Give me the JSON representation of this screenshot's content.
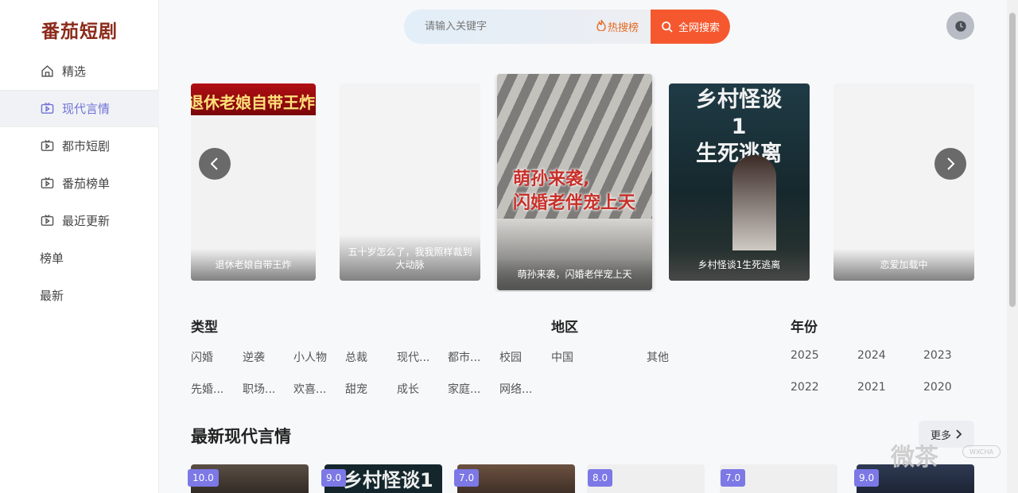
{
  "sidebar": {
    "logo": "番茄短剧",
    "items": [
      {
        "label": "精选",
        "icon": "home-icon"
      },
      {
        "label": "现代言情",
        "icon": "tv-play-icon",
        "active": true
      },
      {
        "label": "都市短剧",
        "icon": "tv-play-icon"
      },
      {
        "label": "番茄榜单",
        "icon": "tv-play-icon"
      },
      {
        "label": "最近更新",
        "icon": "tv-play-icon"
      },
      {
        "label": "榜单",
        "icon": ""
      },
      {
        "label": "最新",
        "icon": ""
      }
    ]
  },
  "header": {
    "search_placeholder": "请输入关键字",
    "hot_label": "热搜榜",
    "search_button": "全网搜索"
  },
  "carousel": {
    "items": [
      {
        "caption": "退休老娘自带王炸",
        "banner": "退休老娘自带王炸"
      },
      {
        "caption": "五十岁怎么了，我我照样裁到大动脉"
      },
      {
        "caption": "萌孙来袭，闪婚老伴宠上天",
        "poster_line1": "萌孙来袭,",
        "poster_line2": "闪婚老伴宠上天"
      },
      {
        "caption": "乡村怪谈1生死逃离",
        "poster_line1": "乡村怪谈1",
        "poster_line2": "生死逃离"
      },
      {
        "caption": "恋爱加载中"
      }
    ]
  },
  "filters": {
    "type_title": "类型",
    "type_tags": [
      "闪婚",
      "逆袭",
      "小人物",
      "总裁",
      "现代...",
      "都市...",
      "校园",
      "先婚...",
      "职场...",
      "欢喜...",
      "甜宠",
      "成长",
      "家庭...",
      "网络..."
    ],
    "region_title": "地区",
    "region_tags": [
      "中国",
      "其他"
    ],
    "year_title": "年份",
    "year_tags": [
      "2025",
      "2024",
      "2023",
      "2022",
      "2021",
      "2020"
    ]
  },
  "latest": {
    "title": "最新现代言情",
    "more_label": "更多",
    "scores": [
      "10.0",
      "9.0",
      "7.0",
      "8.0",
      "7.0",
      "9.0"
    ],
    "thumb2_text": "乡村怪谈1"
  },
  "watermark": {
    "main": "微茶",
    "small": "WXCHA"
  },
  "colors": {
    "accent": "#6f73d6",
    "search_button": "#f5582f",
    "hot": "#e56a22",
    "score_badge": "#7c78e6",
    "logo": "#8b2a1a"
  }
}
